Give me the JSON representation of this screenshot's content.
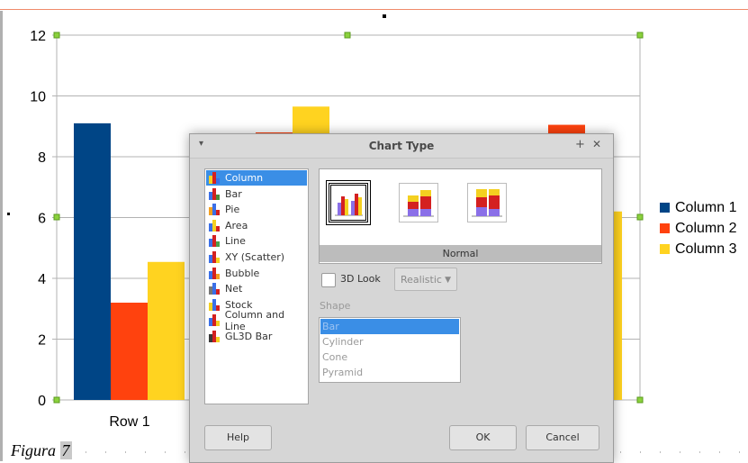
{
  "chart": {
    "legend": [
      {
        "label": "Column 1",
        "color": "#004586"
      },
      {
        "label": "Column 2",
        "color": "#ff420e"
      },
      {
        "label": "Column 3",
        "color": "#ffd320"
      }
    ],
    "caption": {
      "word": "Figura",
      "number": "7"
    }
  },
  "chart_data": {
    "type": "bar",
    "categories": [
      "Row 1"
    ],
    "series": [
      {
        "name": "Column 1",
        "values": [
          9.1
        ]
      },
      {
        "name": "Column 2",
        "values": [
          3.2
        ]
      },
      {
        "name": "Column 3",
        "values": [
          4.54
        ]
      }
    ],
    "ylim": [
      0,
      12
    ],
    "yticks": [
      0,
      2,
      4,
      6,
      8,
      10,
      12
    ],
    "grid": true,
    "legend_position": "right"
  },
  "dialog": {
    "title": "Chart Type",
    "chart_types": [
      {
        "label": "Column",
        "icon": "column-chart-icon",
        "selected": true
      },
      {
        "label": "Bar",
        "icon": "bar-chart-icon"
      },
      {
        "label": "Pie",
        "icon": "pie-chart-icon"
      },
      {
        "label": "Area",
        "icon": "area-chart-icon"
      },
      {
        "label": "Line",
        "icon": "line-chart-icon"
      },
      {
        "label": "XY (Scatter)",
        "icon": "scatter-chart-icon"
      },
      {
        "label": "Bubble",
        "icon": "bubble-chart-icon"
      },
      {
        "label": "Net",
        "icon": "net-chart-icon"
      },
      {
        "label": "Stock",
        "icon": "stock-chart-icon"
      },
      {
        "label": "Column and Line",
        "icon": "column-line-chart-icon"
      },
      {
        "label": "GL3D Bar",
        "icon": "gl3d-bar-chart-icon"
      }
    ],
    "variant_label": "Normal",
    "look3d_label": "3D Look",
    "look3d_checked": false,
    "look3d_style": "Realistic",
    "shape_label": "Shape",
    "shapes": [
      {
        "label": "Bar",
        "selected": true
      },
      {
        "label": "Cylinder"
      },
      {
        "label": "Cone"
      },
      {
        "label": "Pyramid"
      }
    ],
    "buttons": {
      "help": "Help",
      "ok": "OK",
      "cancel": "Cancel"
    }
  }
}
